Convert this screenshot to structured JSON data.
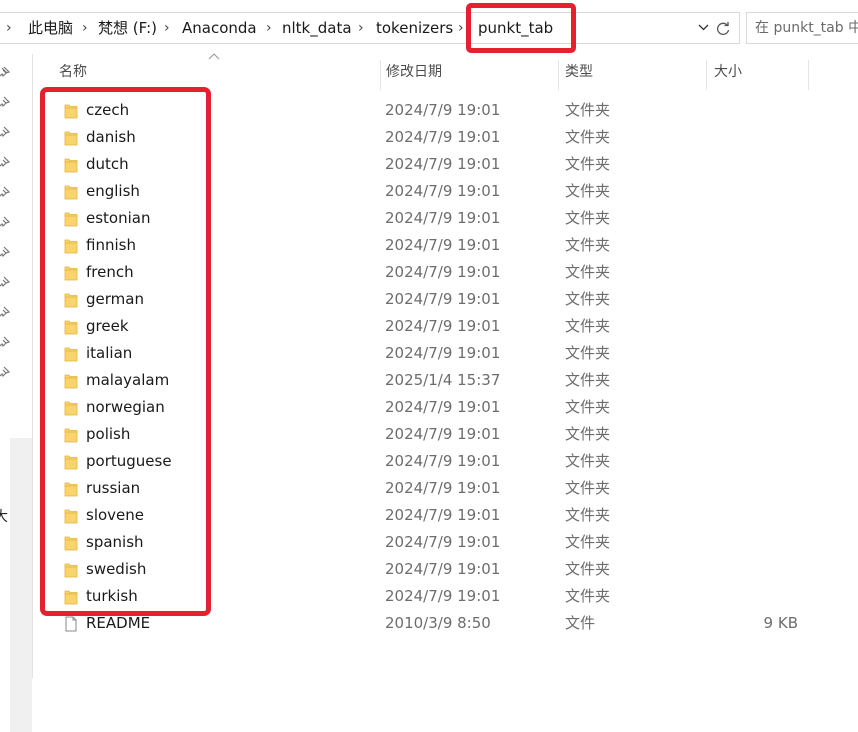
{
  "address_bar": {
    "breadcrumbs": [
      {
        "label": "此电脑"
      },
      {
        "label": "梵想 (F:)"
      },
      {
        "label": "Anaconda"
      },
      {
        "label": "nltk_data"
      },
      {
        "label": "tokenizers"
      },
      {
        "label": "punkt_tab"
      }
    ],
    "separator": "›"
  },
  "search": {
    "placeholder": "在 punkt_tab 中搜索"
  },
  "nav_pane": {
    "cut_text": "大"
  },
  "columns": {
    "name": "名称",
    "date": "修改日期",
    "type": "类型",
    "size": "大小"
  },
  "files": [
    {
      "name": "czech",
      "date": "2024/7/9 19:01",
      "type": "文件夹",
      "size": "",
      "kind": "folder"
    },
    {
      "name": "danish",
      "date": "2024/7/9 19:01",
      "type": "文件夹",
      "size": "",
      "kind": "folder"
    },
    {
      "name": "dutch",
      "date": "2024/7/9 19:01",
      "type": "文件夹",
      "size": "",
      "kind": "folder"
    },
    {
      "name": "english",
      "date": "2024/7/9 19:01",
      "type": "文件夹",
      "size": "",
      "kind": "folder"
    },
    {
      "name": "estonian",
      "date": "2024/7/9 19:01",
      "type": "文件夹",
      "size": "",
      "kind": "folder"
    },
    {
      "name": "finnish",
      "date": "2024/7/9 19:01",
      "type": "文件夹",
      "size": "",
      "kind": "folder"
    },
    {
      "name": "french",
      "date": "2024/7/9 19:01",
      "type": "文件夹",
      "size": "",
      "kind": "folder"
    },
    {
      "name": "german",
      "date": "2024/7/9 19:01",
      "type": "文件夹",
      "size": "",
      "kind": "folder"
    },
    {
      "name": "greek",
      "date": "2024/7/9 19:01",
      "type": "文件夹",
      "size": "",
      "kind": "folder"
    },
    {
      "name": "italian",
      "date": "2024/7/9 19:01",
      "type": "文件夹",
      "size": "",
      "kind": "folder"
    },
    {
      "name": "malayalam",
      "date": "2025/1/4 15:37",
      "type": "文件夹",
      "size": "",
      "kind": "folder"
    },
    {
      "name": "norwegian",
      "date": "2024/7/9 19:01",
      "type": "文件夹",
      "size": "",
      "kind": "folder"
    },
    {
      "name": "polish",
      "date": "2024/7/9 19:01",
      "type": "文件夹",
      "size": "",
      "kind": "folder"
    },
    {
      "name": "portuguese",
      "date": "2024/7/9 19:01",
      "type": "文件夹",
      "size": "",
      "kind": "folder"
    },
    {
      "name": "russian",
      "date": "2024/7/9 19:01",
      "type": "文件夹",
      "size": "",
      "kind": "folder"
    },
    {
      "name": "slovene",
      "date": "2024/7/9 19:01",
      "type": "文件夹",
      "size": "",
      "kind": "folder"
    },
    {
      "name": "spanish",
      "date": "2024/7/9 19:01",
      "type": "文件夹",
      "size": "",
      "kind": "folder"
    },
    {
      "name": "swedish",
      "date": "2024/7/9 19:01",
      "type": "文件夹",
      "size": "",
      "kind": "folder"
    },
    {
      "name": "turkish",
      "date": "2024/7/9 19:01",
      "type": "文件夹",
      "size": "",
      "kind": "folder"
    },
    {
      "name": "README",
      "date": "2010/3/9 8:50",
      "type": "文件",
      "size": "9 KB",
      "kind": "file"
    }
  ],
  "icons": {
    "folder": "folder-icon",
    "file": "file-icon",
    "pin": "pin-icon",
    "dropdown": "chevron-down-icon",
    "refresh": "refresh-icon",
    "sort": "sort-up-icon"
  },
  "colors": {
    "highlight": "#e5212f",
    "folder_yellow": "#f8d46a",
    "folder_dark": "#e3b440"
  }
}
